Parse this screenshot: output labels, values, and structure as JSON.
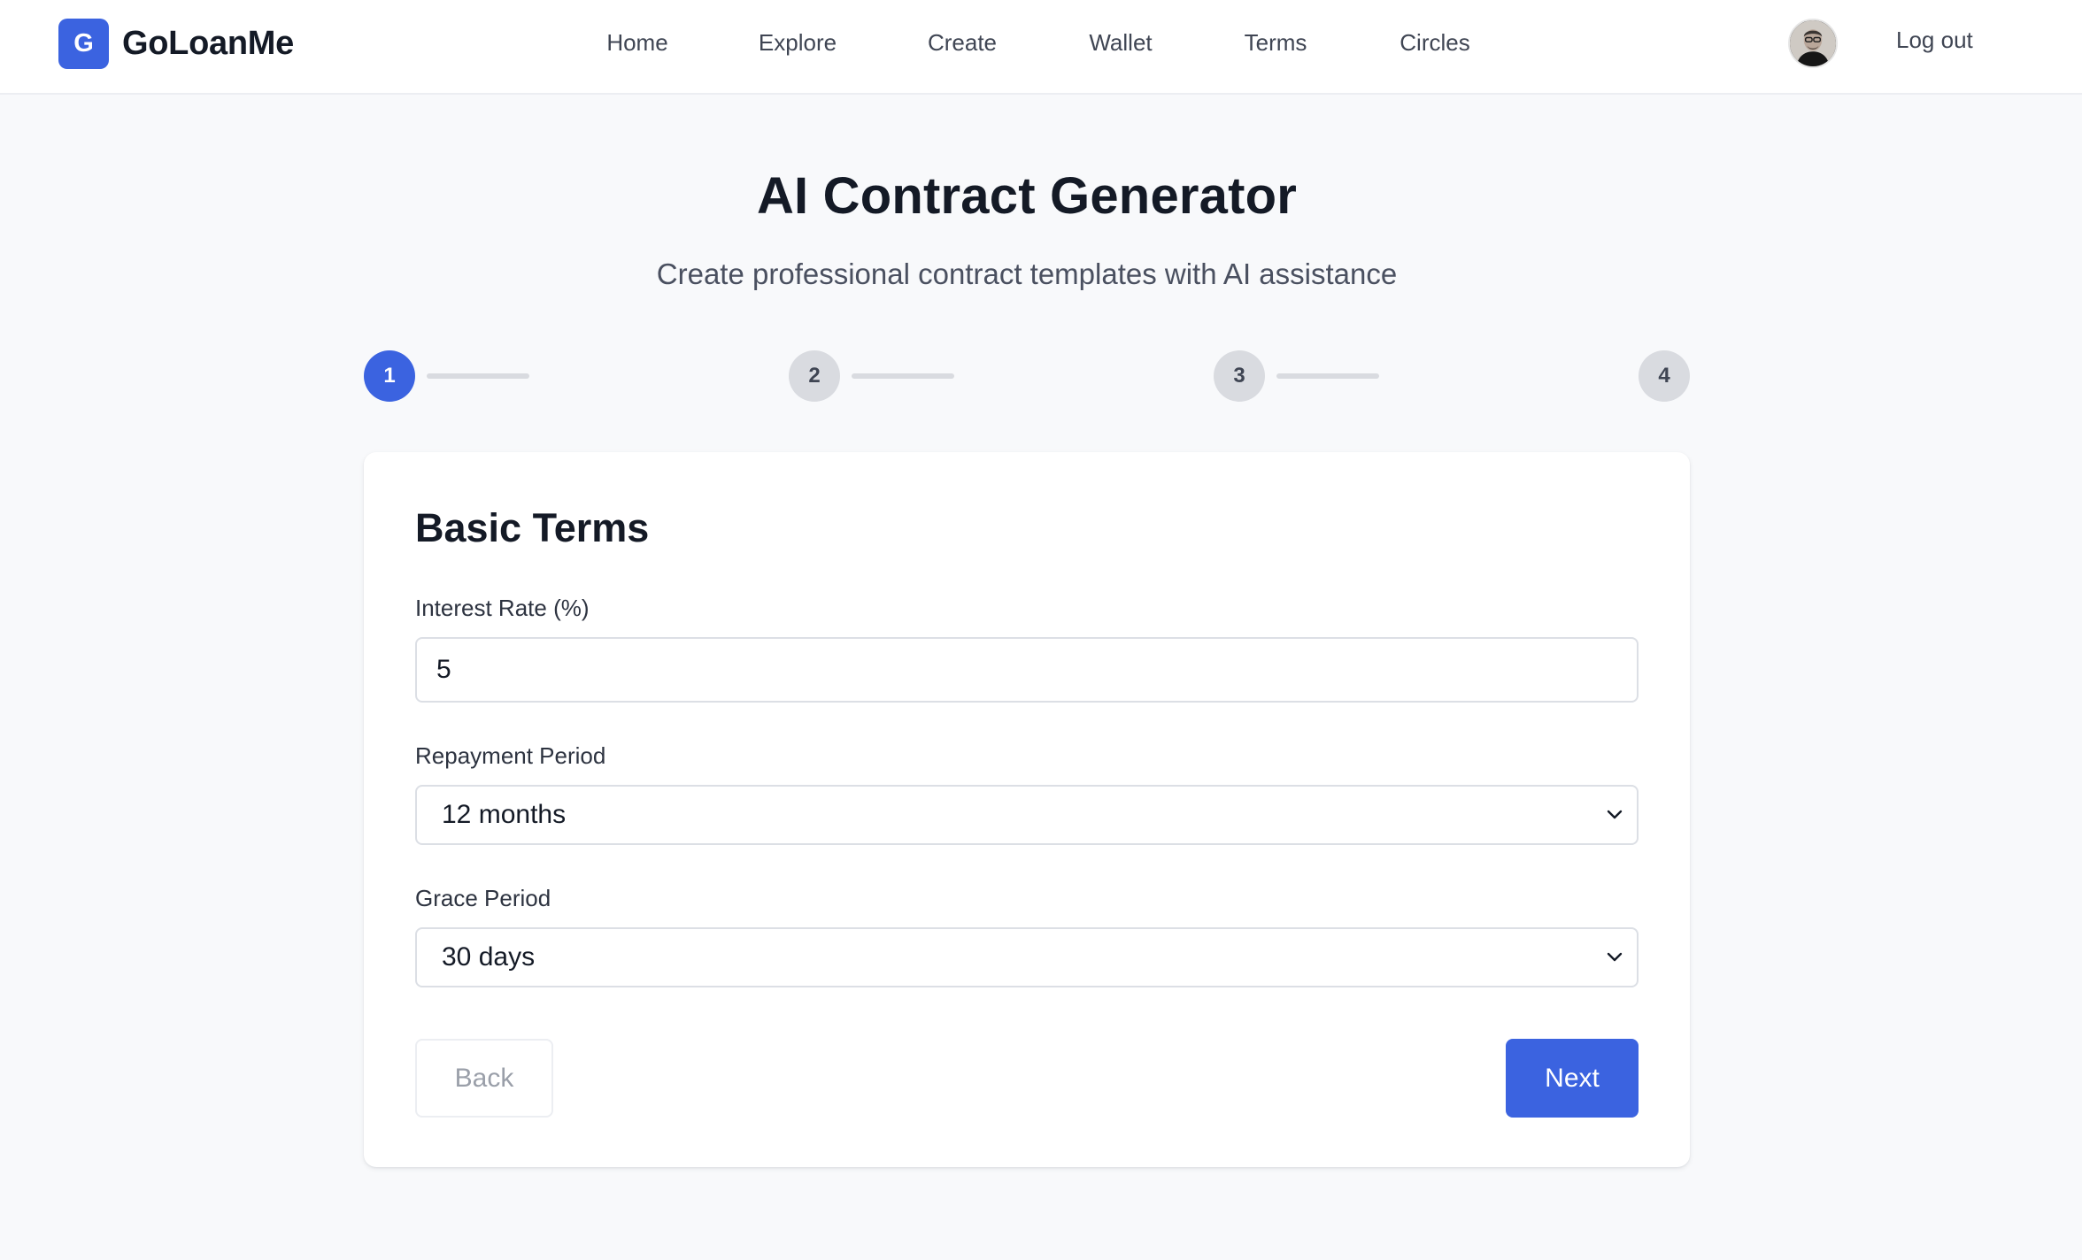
{
  "brand": {
    "initial": "G",
    "name": "GoLoanMe"
  },
  "nav": {
    "items": [
      {
        "label": "Home"
      },
      {
        "label": "Explore"
      },
      {
        "label": "Create"
      },
      {
        "label": "Wallet"
      },
      {
        "label": "Terms"
      },
      {
        "label": "Circles"
      }
    ],
    "logout_label": "Log out",
    "avatar_icon": "user-avatar-photo"
  },
  "page": {
    "title": "AI Contract Generator",
    "subtitle": "Create professional contract templates with AI assistance"
  },
  "stepper": {
    "current_step": 1,
    "steps": [
      {
        "label": "1"
      },
      {
        "label": "2"
      },
      {
        "label": "3"
      },
      {
        "label": "4"
      }
    ]
  },
  "form": {
    "section_title": "Basic Terms",
    "interest_rate": {
      "label": "Interest Rate (%)",
      "value": "5"
    },
    "repayment_period": {
      "label": "Repayment Period",
      "value": "12 months",
      "icon": "chevron-down-icon"
    },
    "grace_period": {
      "label": "Grace Period",
      "value": "30 days",
      "icon": "chevron-down-icon"
    },
    "back_label": "Back",
    "next_label": "Next"
  },
  "colors": {
    "accent": "#3b63e0",
    "background": "#f8f9fb",
    "card": "#ffffff",
    "inactive_step": "#d9dbe0",
    "text_primary": "#141a26",
    "text_muted": "#9a9fa9"
  }
}
